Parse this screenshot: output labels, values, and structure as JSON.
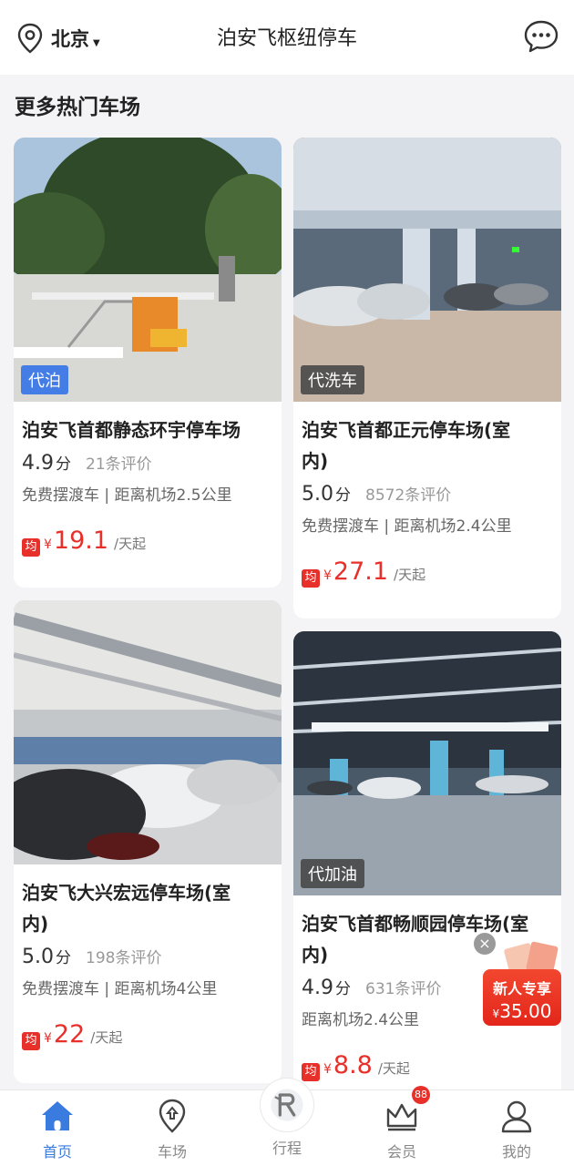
{
  "header": {
    "city": "北京",
    "title": "泊安飞枢纽停车",
    "icons": {
      "location": "location-pin-icon",
      "message": "message-icon"
    }
  },
  "section_title": "更多热门车场",
  "parkings": [
    {
      "tag": "代泊",
      "name": "泊安飞首都静态环宇停车场",
      "score": "4.9",
      "score_unit": "分",
      "reviews": "21条评价",
      "meta": "免费摆渡车 | 距离机场2.5公里",
      "price_badge": "均",
      "currency": "¥",
      "price": "19.1",
      "per": "/天起"
    },
    {
      "tag": "代洗车",
      "name_line1": "泊安飞首都正元停车场(室",
      "name_line2": "内)",
      "score": "5.0",
      "score_unit": "分",
      "reviews": "8572条评价",
      "meta": "免费摆渡车 | 距离机场2.4公里",
      "price_badge": "均",
      "currency": "¥",
      "price": "27.1",
      "per": "/天起"
    },
    {
      "name_line1": "泊安飞大兴宏远停车场(室",
      "name_line2": "内)",
      "score": "5.0",
      "score_unit": "分",
      "reviews": "198条评价",
      "meta": "免费摆渡车 | 距离机场4公里",
      "price_badge": "均",
      "currency": "¥",
      "price": "22",
      "per": "/天起"
    },
    {
      "tag": "代加油",
      "name_line1": "泊安飞首都畅顺园停车场(室",
      "name_line2": "内)",
      "score": "4.9",
      "score_unit": "分",
      "reviews": "631条评价",
      "meta": "距离机场2.4公里",
      "price_badge": "均",
      "currency": "¥",
      "price": "8.8",
      "per": "/天起"
    }
  ],
  "promo": {
    "label": "新人专享",
    "currency": "¥",
    "amount": "35.00",
    "close": "×"
  },
  "tabs": [
    {
      "label": "首页",
      "icon": "home-icon",
      "active": true
    },
    {
      "label": "车场",
      "icon": "map-pin-icon"
    },
    {
      "label": "行程",
      "icon": "trip-icon"
    },
    {
      "label": "会员",
      "icon": "crown-icon",
      "badge": "88"
    },
    {
      "label": "我的",
      "icon": "user-icon"
    }
  ],
  "colors": {
    "accent": "#3a7be0",
    "price": "#e8302a"
  }
}
